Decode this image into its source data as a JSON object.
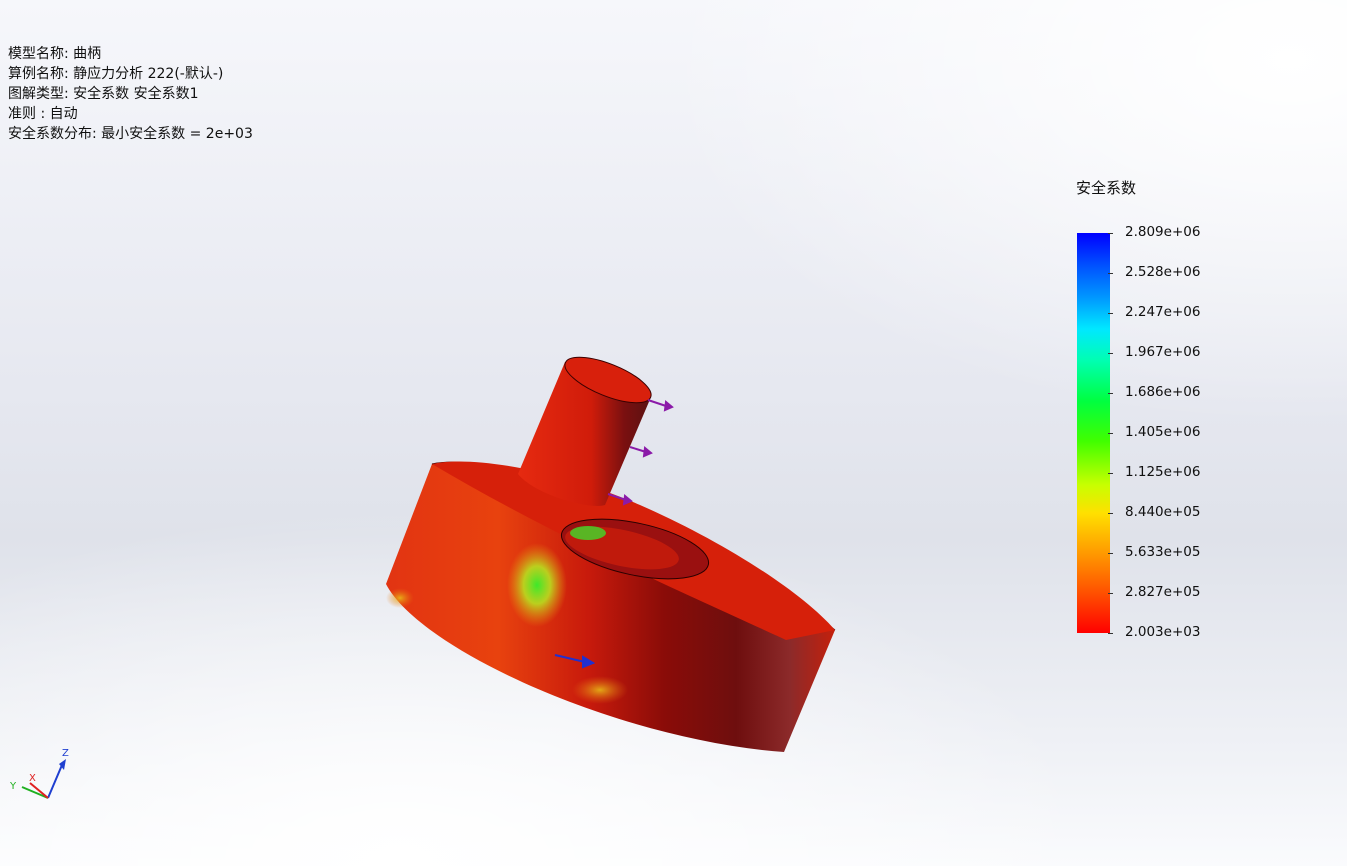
{
  "info": {
    "model_name": "模型名称: 曲柄",
    "study_name": "算例名称: 静应力分析 222(-默认-)",
    "plot_type": "图解类型: 安全系数 安全系数1",
    "criterion": "准则 : 自动",
    "distribution": "安全系数分布: 最小安全系数 = 2e+03"
  },
  "legend": {
    "title": "安全系数",
    "ticks": [
      "2.809e+06",
      "2.528e+06",
      "2.247e+06",
      "1.967e+06",
      "1.686e+06",
      "1.405e+06",
      "1.125e+06",
      "8.440e+05",
      "5.633e+05",
      "2.827e+05",
      "2.003e+03"
    ],
    "color_max": "#0000ff",
    "color_mid": "#00ff40",
    "color_min": "#ff0000"
  },
  "triad": {
    "x_label": "X",
    "y_label": "Y",
    "z_label": "Z",
    "x_color": "#e02020",
    "y_color": "#20b020",
    "z_color": "#1f3fd0"
  },
  "model": {
    "part": "crank",
    "base_color": "#d81e0a",
    "shadow_color": "#7a1414",
    "hotspot_color": "#3ee82a",
    "load_arrow_color": "#8b1aa8",
    "fixture_arrow_color": "#2030d0"
  }
}
